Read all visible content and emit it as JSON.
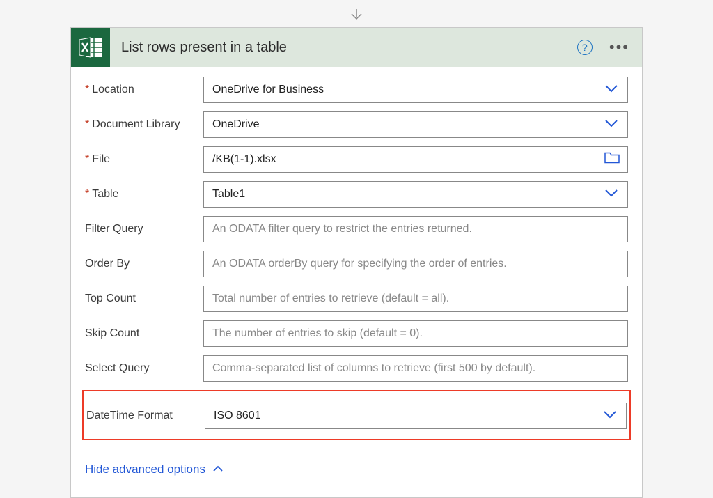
{
  "header": {
    "title": "List rows present in a table"
  },
  "fields": {
    "location": {
      "label": "Location",
      "value": "OneDrive for Business",
      "required": true
    },
    "documentLibrary": {
      "label": "Document Library",
      "value": "OneDrive",
      "required": true
    },
    "file": {
      "label": "File",
      "value": "/KB(1-1).xlsx",
      "required": true
    },
    "table": {
      "label": "Table",
      "value": "Table1",
      "required": true
    },
    "filterQuery": {
      "label": "Filter Query",
      "placeholder": "An ODATA filter query to restrict the entries returned."
    },
    "orderBy": {
      "label": "Order By",
      "placeholder": "An ODATA orderBy query for specifying the order of entries."
    },
    "topCount": {
      "label": "Top Count",
      "placeholder": "Total number of entries to retrieve (default = all)."
    },
    "skipCount": {
      "label": "Skip Count",
      "placeholder": "The number of entries to skip (default = 0)."
    },
    "selectQuery": {
      "label": "Select Query",
      "placeholder": "Comma-separated list of columns to retrieve (first 500 by default)."
    },
    "dateTimeFormat": {
      "label": "DateTime Format",
      "value": "ISO 8601"
    }
  },
  "footer": {
    "hideAdvanced": "Hide advanced options"
  }
}
